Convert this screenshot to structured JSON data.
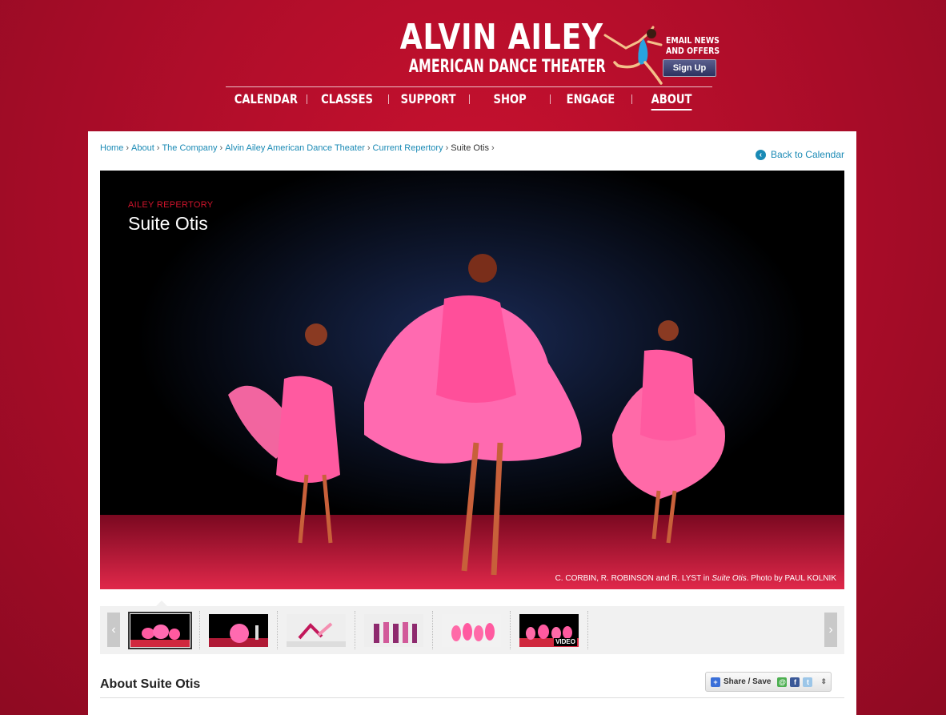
{
  "header": {
    "logo_line1": "ALVIN AILEY",
    "logo_line2": "AMERICAN DANCE THEATER",
    "nav": [
      "CALENDAR",
      "CLASSES",
      "SUPPORT",
      "SHOP",
      "ENGAGE",
      "ABOUT"
    ],
    "active_nav": "ABOUT",
    "promo_line1": "EMAIL NEWS",
    "promo_line2": "AND OFFERS",
    "signup_label": "Sign Up"
  },
  "breadcrumb": {
    "items": [
      "Home",
      "About",
      "The Company",
      "Alvin Ailey American Dance Theater",
      "Current Repertory"
    ],
    "current": "Suite Otis",
    "separator": "›"
  },
  "back_link": "Back to Calendar",
  "hero": {
    "kicker": "AILEY REPERTORY",
    "title": "Suite Otis",
    "caption_prefix": "C. CORBIN, R. ROBINSON and R. LYST in ",
    "caption_work": "Suite Otis",
    "caption_suffix": ". Photo by PAUL KOLNIK"
  },
  "thumbnails": {
    "count": 6,
    "active_index": 0,
    "video_label": "VIDEO",
    "prev_icon": "‹",
    "next_icon": "›"
  },
  "about": {
    "heading": "About Suite Otis"
  },
  "share": {
    "label": "Share / Save"
  },
  "colors": {
    "background": "#b00d2a",
    "link": "#1a8ab5",
    "kicker": "#d0142c",
    "costume_pink": "#ff4f9a"
  }
}
